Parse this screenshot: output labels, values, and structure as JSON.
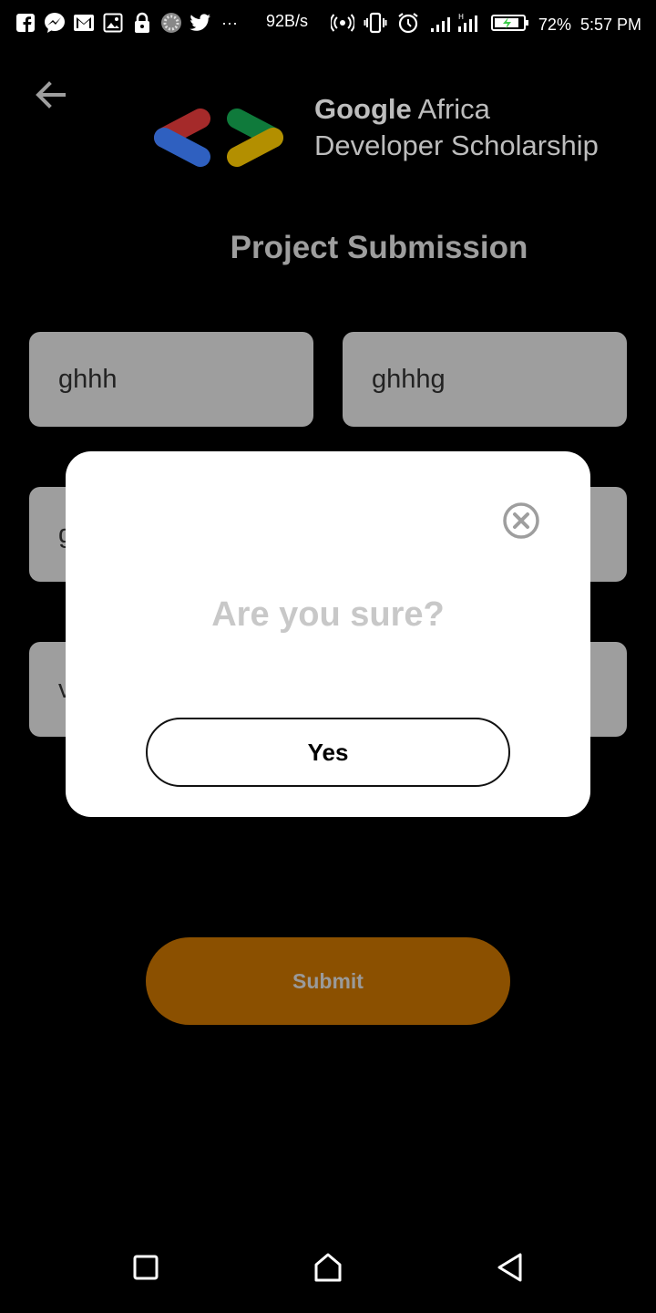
{
  "status_bar": {
    "net_speed": "92B/s",
    "battery": "72%",
    "time": "5:57 PM",
    "left_icons": [
      "facebook-icon",
      "messenger-icon",
      "gmail-icon",
      "gallery-icon",
      "lock-icon",
      "loading-icon",
      "twitter-icon",
      "more-icon"
    ]
  },
  "header": {
    "brand_bold": "Google",
    "brand_rest": " Africa",
    "brand_line2": "Developer Scholarship",
    "page_title": "Project Submission"
  },
  "form": {
    "first_name": "ghhh",
    "last_name": "ghhhg",
    "email_partial": "g",
    "link_partial": "v"
  },
  "submit_label": "Submit",
  "dialog": {
    "title": "Are you sure?",
    "confirm_label": "Yes"
  },
  "colors": {
    "background": "#000000",
    "field": "#9e9e9e",
    "submit": "#8b5000",
    "logo_red": "#a52a2a",
    "logo_blue": "#2f60c0",
    "logo_green": "#0f7a3b",
    "logo_yellow": "#b38f00"
  }
}
